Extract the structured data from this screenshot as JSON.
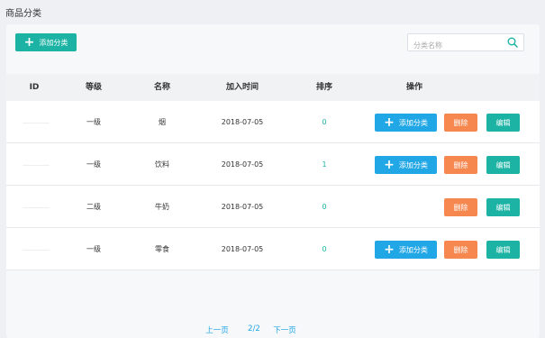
{
  "page": {
    "title": "商品分类"
  },
  "toolbar": {
    "add_label": "添加分类",
    "search_placeholder": "分类名称"
  },
  "table": {
    "headers": [
      "ID",
      "等级",
      "名称",
      "加入时间",
      "排序",
      "操作"
    ],
    "rows": [
      {
        "id": "",
        "level": "一级",
        "name": "烟",
        "date": "2018-07-05",
        "sort": "0",
        "add": "添加分类",
        "delete": "删除",
        "edit": "编辑"
      },
      {
        "id": "",
        "level": "一级",
        "name": "饮料",
        "date": "2018-07-05",
        "sort": "1",
        "add": "添加分类",
        "delete": "删除",
        "edit": "编辑"
      },
      {
        "id": "",
        "level": "二级",
        "name": "牛奶",
        "date": "2018-07-05",
        "sort": "0",
        "delete": "删除",
        "edit": "编辑"
      },
      {
        "id": "",
        "level": "一级",
        "name": "零食",
        "date": "2018-07-05",
        "sort": "0",
        "add": "添加分类",
        "delete": "删除",
        "edit": "编辑"
      }
    ]
  },
  "pagination": {
    "prev": "上一页",
    "info": "2/2",
    "next": "下一页"
  },
  "colors": {
    "teal": "#1cb3a4",
    "blue": "#22a7e6",
    "orange": "#f5874f"
  }
}
